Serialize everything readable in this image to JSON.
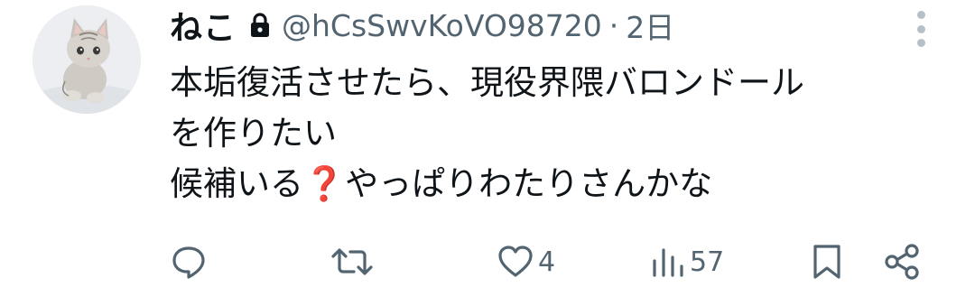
{
  "tweet": {
    "display_name": "ねこ",
    "handle": "@hCsSwvKoVO98720",
    "separator": "·",
    "time": "2日",
    "avatar_icon": "kitten-avatar",
    "lock_icon": "lock-icon",
    "more_icon": "more-vertical-icon",
    "body_lines": [
      "本垢復活させたら、現役界隈バロンドール",
      "を作りたい",
      "候補いる",
      "やっぱりわたりさんかな"
    ],
    "emoji": "❓"
  },
  "actions": {
    "reply": {
      "icon": "reply-icon",
      "count": ""
    },
    "retweet": {
      "icon": "retweet-icon",
      "count": ""
    },
    "like": {
      "icon": "heart-icon",
      "count": "4"
    },
    "views": {
      "icon": "views-icon",
      "count": "57"
    },
    "bookmark": {
      "icon": "bookmark-icon"
    },
    "share": {
      "icon": "share-icon"
    }
  },
  "colors": {
    "text": "#0f1419",
    "secondary": "#536471",
    "emoji_red": "#e0245e"
  }
}
